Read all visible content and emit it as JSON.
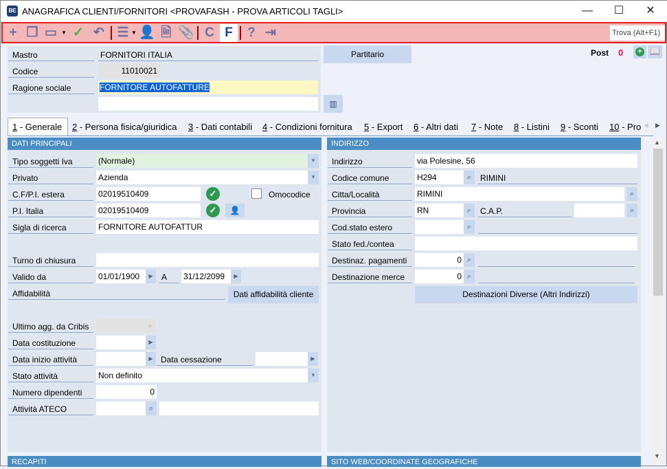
{
  "window": {
    "title": "ANAGRAFICA CLIENTI/FORNITORI <PROVAFASH - PROVA ARTICOLI TAGLI>",
    "app_icon": "BE",
    "minimize": "—",
    "maximize": "☐",
    "close": "✕"
  },
  "toolbar": {
    "search_placeholder": "Trova (Alt+F1)",
    "c_label": "C",
    "f_label": "F"
  },
  "header": {
    "mastro_label": "Mastro",
    "mastro_value": "FORNITORI ITALIA",
    "codice_label": "Codice",
    "codice_value": "11010021",
    "ragione_label": "Ragione sociale",
    "ragione_value": "FORNITORE AUTOFATTURE",
    "ragione_value2": "",
    "partitario": "Partitario",
    "post_label": "Post",
    "post_count": "0"
  },
  "tabs": [
    {
      "num": "1",
      "label": " - Generale"
    },
    {
      "num": "2",
      "label": " - Persona fisica/giuridica"
    },
    {
      "num": "3",
      "label": " - Dati contabili"
    },
    {
      "num": "4",
      "label": " - Condizioni fornitura"
    },
    {
      "num": "5",
      "label": " - Export"
    },
    {
      "num": "6",
      "label": " - Altri dati"
    },
    {
      "num": "7",
      "label": " - Note"
    },
    {
      "num": "8",
      "label": " - Listini"
    },
    {
      "num": "9",
      "label": " - Sconti"
    },
    {
      "num": "10",
      "label": " - Pro"
    }
  ],
  "left": {
    "title": "DATI PRINCIPALI",
    "tipo_label": "Tipo soggetti Iva",
    "tipo_value": "(Normale)",
    "privato_label": "Privato",
    "privato_value": "Azienda",
    "cf_label": "C.F/P.I. estera",
    "cf_value": "02019510409",
    "omocodice": "Omocodice",
    "pi_label": "P.I. Italia",
    "pi_value": "02019510409",
    "sigla_label": "Sigla di ricerca",
    "sigla_value": "FORNITORE AUTOFATTUR",
    "turno_label": "Turno di chiusura",
    "turno_value": "",
    "valido_label": "Valido da",
    "valido_da": "01/01/1900",
    "a_label": "A",
    "valido_a": "31/12/2099",
    "affid_label": "Affidabilità",
    "affid_button": "Dati affidabilità cliente",
    "cribis_label": "Ultimo agg. da Cribis",
    "costituzione_label": "Data costituzione",
    "inizio_label": "Data inizio attività",
    "cessazione_label": "Data cessazione",
    "stato_label": "Stato attività",
    "stato_value": "Non definito",
    "dipendenti_label": "Numero dipendenti",
    "dipendenti_value": "0",
    "ateco_label": "Attività ATECO"
  },
  "right": {
    "title": "INDIRIZZO",
    "indirizzo_label": "Indirizzo",
    "indirizzo_value": "via Polesine, 56",
    "comune_label": "Codice comune",
    "comune_code": "H294",
    "comune_name": "RIMINI",
    "citta_label": "Citta/Località",
    "citta_value": "RIMINI",
    "provincia_label": "Provincia",
    "provincia_value": "RN",
    "cap_label": "C.A.P.",
    "cap_value": "",
    "estero_label": "Cod.stato estero",
    "statofed_label": "Stato fed./contea",
    "destpag_label": "Destinaz. pagamenti",
    "destpag_value": "0",
    "destmerce_label": "Destinazione merce",
    "destmerce_value": "0",
    "dest_button": "Destinazioni Diverse (Altri Indirizzi)"
  },
  "bottom": {
    "left_title": "RECAPITI",
    "right_title": "SITO WEB/COORDINATE GEOGRAFICHE"
  }
}
